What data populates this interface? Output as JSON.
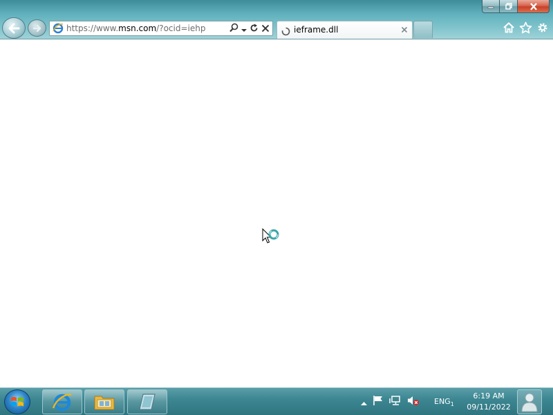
{
  "browser": {
    "address": {
      "prefix": "https://www.",
      "host": "msn.com",
      "path": "/?ocid=iehp"
    },
    "tab": {
      "title": "ieframe.dll"
    }
  },
  "taskbar": {
    "language": "ENG",
    "language_index": "1",
    "time": "6:19 AM",
    "date": "09/11/2022"
  },
  "colors": {
    "chrome_accent": "#5fb0bd",
    "taskbar": "#3d8792",
    "close_red": "#c8402a"
  },
  "icons": {
    "window": [
      "minimize-icon",
      "maximize-icon",
      "close-icon"
    ],
    "nav": [
      "back-arrow-icon",
      "forward-arrow-icon"
    ],
    "address": [
      "ie-page-icon",
      "search-icon",
      "dropdown-icon",
      "refresh-icon",
      "stop-icon"
    ],
    "toolbar": [
      "home-icon",
      "favorites-star-icon",
      "settings-gear-icon"
    ],
    "taskbar": [
      "windows-start-icon",
      "internet-explorer-icon",
      "file-explorer-icon",
      "app-icon",
      "show-hidden-icons",
      "action-center-flag-icon",
      "network-icon",
      "volume-muted-icon",
      "user-icon"
    ]
  }
}
